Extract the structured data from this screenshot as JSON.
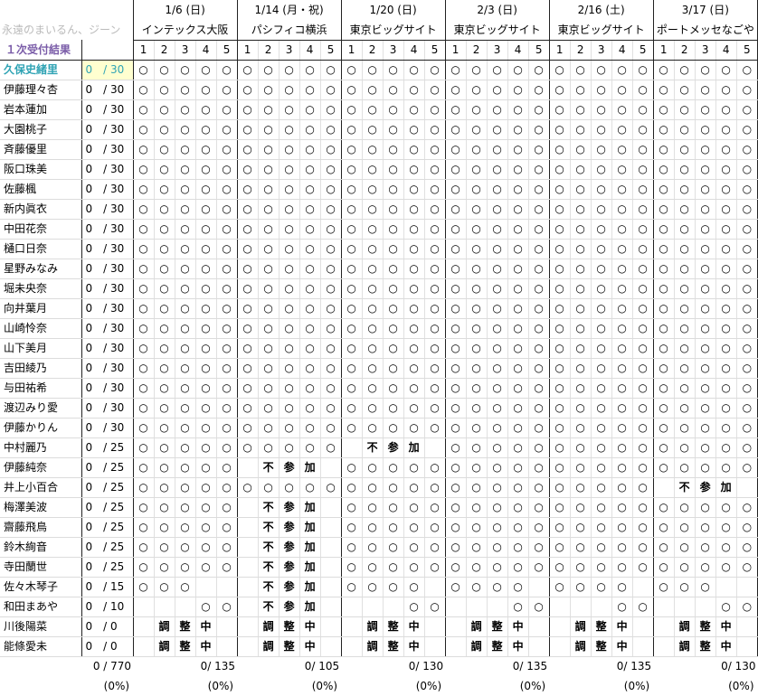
{
  "header": {
    "watermark": "永遠のまいるん、ジーン",
    "result_label": "１次受付結果",
    "part_numbers": [
      "1",
      "2",
      "3",
      "4",
      "5"
    ]
  },
  "events": [
    {
      "date": "1/6 (日)",
      "venue": "インテックス大阪"
    },
    {
      "date": "1/14 (月・祝)",
      "venue": "パシフィコ横浜"
    },
    {
      "date": "1/20 (日)",
      "venue": "東京ビッグサイト"
    },
    {
      "date": "2/3 (日)",
      "venue": "東京ビッグサイト"
    },
    {
      "date": "2/16 (土)",
      "venue": "東京ビッグサイト"
    },
    {
      "date": "3/17 (日)",
      "venue": "ポートメッセなごや"
    }
  ],
  "symbols": {
    "circle": "○",
    "fu": "不",
    "san": "参",
    "ka": "加",
    "cho": "調",
    "sei": "整",
    "chu": "中"
  },
  "members": [
    {
      "name": "久保史緒里",
      "count": "0　/ 30",
      "cells": "oooooooooooooooooooooooooooooo"
    },
    {
      "name": "伊藤理々杏",
      "count": "0　/ 30",
      "cells": "oooooooooooooooooooooooooooooo"
    },
    {
      "name": "岩本蓮加",
      "count": "0　/ 30",
      "cells": "oooooooooooooooooooooooooooooo"
    },
    {
      "name": "大園桃子",
      "count": "0　/ 30",
      "cells": "oooooooooooooooooooooooooooooo"
    },
    {
      "name": "斉藤優里",
      "count": "0　/ 30",
      "cells": "oooooooooooooooooooooooooooooo"
    },
    {
      "name": "阪口珠美",
      "count": "0　/ 30",
      "cells": "oooooooooooooooooooooooooooooo"
    },
    {
      "name": "佐藤楓",
      "count": "0　/ 30",
      "cells": "oooooooooooooooooooooooooooooo"
    },
    {
      "name": "新内眞衣",
      "count": "0　/ 30",
      "cells": "oooooooooooooooooooooooooooooo"
    },
    {
      "name": "中田花奈",
      "count": "0　/ 30",
      "cells": "oooooooooooooooooooooooooooooo"
    },
    {
      "name": "樋口日奈",
      "count": "0　/ 30",
      "cells": "oooooooooooooooooooooooooooooo"
    },
    {
      "name": "星野みなみ",
      "count": "0　/ 30",
      "cells": "oooooooooooooooooooooooooooooo"
    },
    {
      "name": "堀未央奈",
      "count": "0　/ 30",
      "cells": "oooooooooooooooooooooooooooooo"
    },
    {
      "name": "向井葉月",
      "count": "0　/ 30",
      "cells": "oooooooooooooooooooooooooooooo"
    },
    {
      "name": "山崎怜奈",
      "count": "0　/ 30",
      "cells": "oooooooooooooooooooooooooooooo"
    },
    {
      "name": "山下美月",
      "count": "0　/ 30",
      "cells": "oooooooooooooooooooooooooooooo"
    },
    {
      "name": "吉田綾乃",
      "count": "0　/ 30",
      "cells": "oooooooooooooooooooooooooooooo"
    },
    {
      "name": "与田祐希",
      "count": "0　/ 30",
      "cells": "oooooooooooooooooooooooooooooo"
    },
    {
      "name": "渡辺みり愛",
      "count": "0　/ 30",
      "cells": "oooooooooooooooooooooooooooooo"
    },
    {
      "name": "伊藤かりん",
      "count": "0　/ 30",
      "cells": "oooooooooooooooooooooooooooooo"
    },
    {
      "name": "中村麗乃",
      "count": "0　/ 25",
      "cells": "oooooooooo.FSK.ooooooooooooooo"
    },
    {
      "name": "伊藤純奈",
      "count": "0　/ 25",
      "cells": "ooooo.FSK.oooooooooooooooooooo"
    },
    {
      "name": "井上小百合",
      "count": "0　/ 25",
      "cells": "ooooooooooooooooooooooooo.FSK."
    },
    {
      "name": "梅澤美波",
      "count": "0　/ 25",
      "cells": "ooooo.FSK.oooooooooooooooooooo"
    },
    {
      "name": "齋藤飛鳥",
      "count": "0　/ 25",
      "cells": "ooooo.FSK.oooooooooooooooooooo"
    },
    {
      "name": "鈴木絢音",
      "count": "0　/ 25",
      "cells": "ooooo.FSK.oooooooooooooooooooo"
    },
    {
      "name": "寺田蘭世",
      "count": "0　/ 25",
      "cells": "ooooo.FSK.oooooooooooooooooooo"
    },
    {
      "name": "佐々木琴子",
      "count": "0　/ 15",
      "cells": "ooo...FSK.oooo.oooo.oooo.ooo.."
    },
    {
      "name": "和田まあや",
      "count": "0　/ 10",
      "cells": "...oo.FSK....oo...oo...oo...oo"
    },
    {
      "name": "川後陽菜",
      "count": "0　/ 0",
      "cells": ".CSZ..CSZ..CSZ..CSZ..CSZ..CSZ."
    },
    {
      "name": "能條愛未",
      "count": "0　/ 0",
      "cells": ".CSZ..CSZ..CSZ..CSZ..CSZ..CSZ."
    }
  ],
  "footer": {
    "total": "0 / 770",
    "total_pct": "(0%)",
    "events": [
      {
        "total": "0/ 135",
        "pct": "(0%)"
      },
      {
        "total": "0/ 105",
        "pct": "(0%)"
      },
      {
        "total": "0/ 130",
        "pct": "(0%)"
      },
      {
        "total": "0/ 135",
        "pct": "(0%)"
      },
      {
        "total": "0/ 135",
        "pct": "(0%)"
      },
      {
        "total": "0/ 130",
        "pct": "(0%)"
      }
    ]
  }
}
